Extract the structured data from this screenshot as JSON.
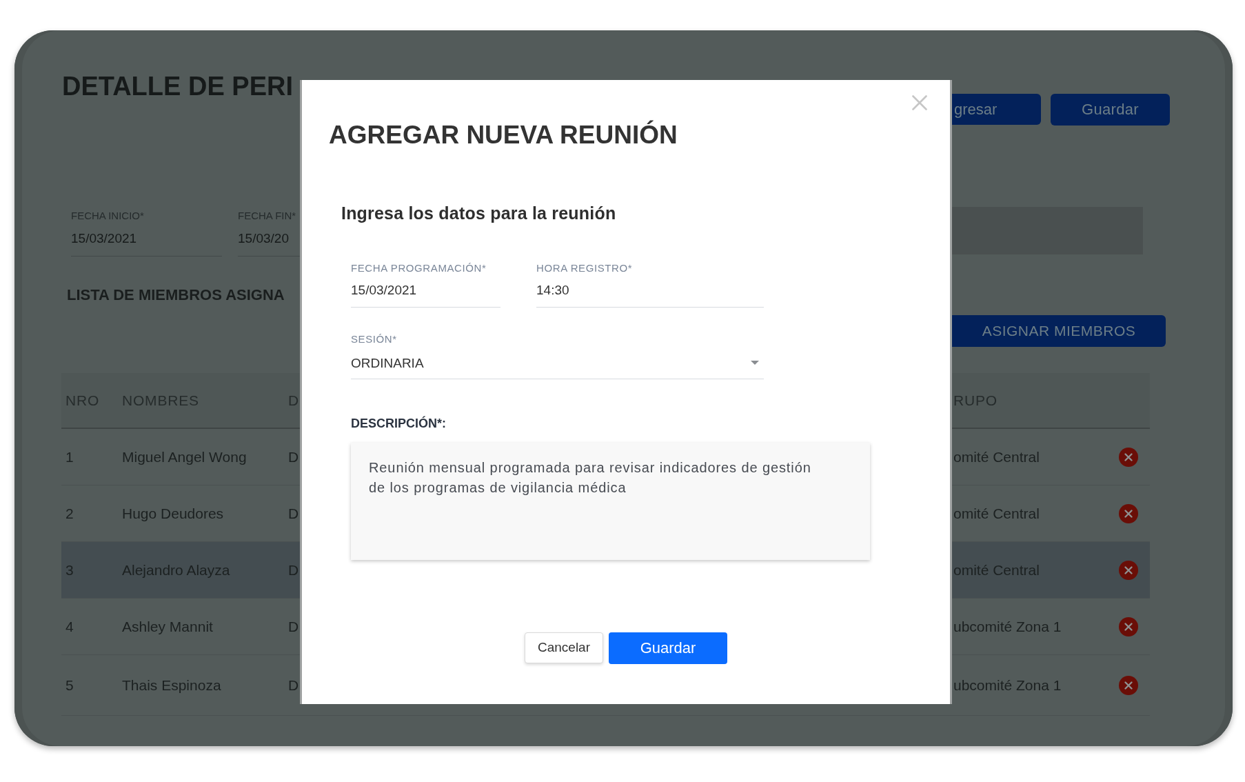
{
  "page": {
    "title": "DETALLE DE PERI",
    "actions": [
      {
        "label": "gresar",
        "kind": "back"
      },
      {
        "label": "Guardar",
        "kind": "save"
      }
    ],
    "period_fields": [
      {
        "label": "FECHA INICIO*",
        "value": "15/03/2021"
      },
      {
        "label": "FECHA FIN*",
        "value": "15/03/20"
      }
    ]
  },
  "members": {
    "title": "LISTA DE MIEMBROS ASIGNA",
    "assign_button": "ASIGNAR MIEMBROS"
  },
  "table": {
    "columns": [
      "NRO",
      "NOMBRES",
      "D",
      "RUPO"
    ],
    "rows": [
      {
        "nro": "1",
        "name": "Miguel Angel Wong",
        "column_3": "D",
        "group": "omité Central",
        "selected": false
      },
      {
        "nro": "2",
        "name": "Hugo Deudores",
        "column_3": "D",
        "group": "omité Central",
        "selected": false
      },
      {
        "nro": "3",
        "name": "Alejandro Alayza",
        "column_3": "D",
        "group": "omité Central",
        "selected": true
      },
      {
        "nro": "4",
        "name": "Ashley Mannit",
        "column_3": "D",
        "group": "ubcomité Zona 1",
        "selected": false
      },
      {
        "nro": "5",
        "name": "Thais Espinoza",
        "column_3": "D",
        "group": "ubcomité Zona 1",
        "selected": false
      }
    ]
  },
  "dialog": {
    "title": "AGREGAR NUEVA REUNIÓN",
    "subtitle": "Ingresa los datos para la reunión",
    "fields": [
      {
        "kind": "date",
        "label": "FECHA PROGRAMACIÓN*",
        "value": "15/03/2021"
      },
      {
        "kind": "time",
        "label": "HORA REGISTRO*",
        "value": "14:30"
      }
    ],
    "session": {
      "label": "SESIÓN*",
      "value": "ORDINARIA"
    },
    "description": {
      "label": "DESCRIPCIÓN*:",
      "value": "Reunión mensual programada para revisar indicadores de gestión de los programas de vigilancia médica"
    },
    "buttons": [
      {
        "label": "Cancelar",
        "kind": "secondary"
      },
      {
        "label": "Guardar",
        "kind": "primary"
      }
    ]
  }
}
